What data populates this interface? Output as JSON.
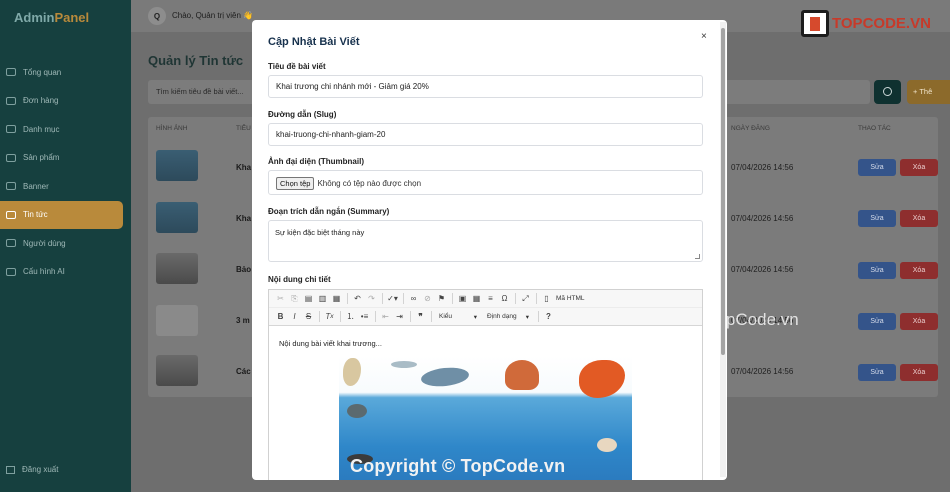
{
  "brand": {
    "part1": "Admin",
    "part2": "Panel"
  },
  "sidebar": {
    "items": [
      {
        "label": "Tổng quan"
      },
      {
        "label": "Đơn hàng"
      },
      {
        "label": "Danh mục"
      },
      {
        "label": "Sản phẩm"
      },
      {
        "label": "Banner"
      },
      {
        "label": "Tin tức",
        "active": true
      },
      {
        "label": "Người dùng"
      },
      {
        "label": "Cấu hình AI"
      }
    ],
    "logout": "Đăng xuất"
  },
  "header": {
    "avatar_letter": "Q",
    "greeting": "Chào, Quản trị viên 👋"
  },
  "page": {
    "title": "Quản lý Tin tức",
    "search_placeholder": "Tìm kiếm tiêu đề bài viết...",
    "add_label": "+ Thê"
  },
  "table": {
    "headers": [
      "HÌNH ẢNH",
      "TIÊU",
      "NGÀY ĐĂNG",
      "THAO TÁC"
    ],
    "rows": [
      {
        "title": "Kha",
        "date": "07/04/2026 14:56"
      },
      {
        "title": "Kha",
        "date": "07/04/2026 14:56"
      },
      {
        "title": "Bảo",
        "date": "07/04/2026 14:56"
      },
      {
        "title": "3 m",
        "date": "07/04/2026 14:56"
      },
      {
        "title": "Các",
        "date": "07/04/2026 14:56"
      }
    ],
    "edit_label": "Sửa",
    "delete_label": "Xóa"
  },
  "modal": {
    "title": "Cập Nhật Bài Viết",
    "close": "×",
    "fields": {
      "title_label": "Tiêu đề bài viết",
      "title_value": "Khai trương chi nhánh mới - Giảm giá 20%",
      "slug_label": "Đường dẫn (Slug)",
      "slug_value": "khai-truong-chi-nhanh-giam-20",
      "thumb_label": "Ảnh đại diện (Thumbnail)",
      "file_button": "Chọn tệp",
      "file_status": "Không có tệp nào được chọn",
      "summary_label": "Đoạn trích dẫn ngắn (Summary)",
      "summary_value": "Sự kiện đặc biệt tháng này",
      "content_label": "Nội dung chi tiết"
    },
    "editor": {
      "source_label": "Mã HTML",
      "styles_label": "Kiểu",
      "format_label": "Định dạng",
      "body_text": "Nội dung bài viết khai trương..."
    }
  },
  "watermarks": {
    "logo_text": "TOPCODE.VN",
    "middle": "TopCode.vn",
    "bottom": "Copyright © TopCode.vn"
  }
}
